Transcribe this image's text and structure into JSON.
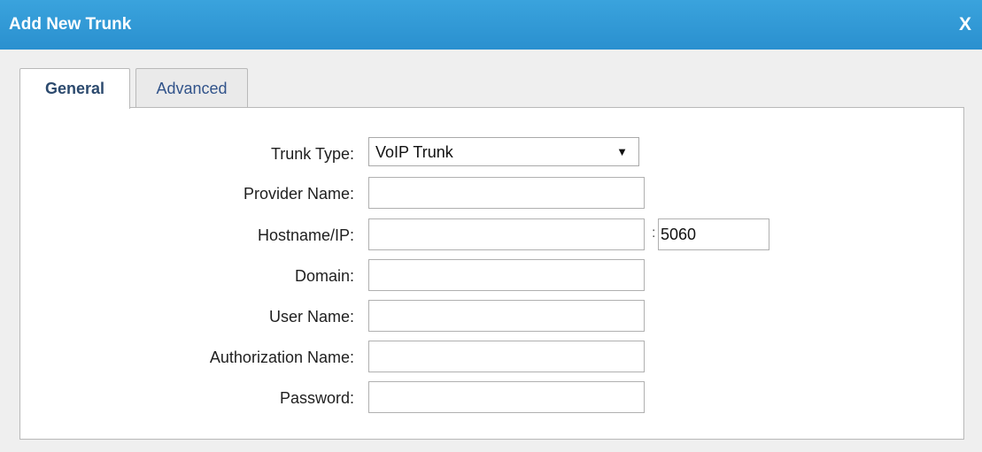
{
  "dialog": {
    "title": "Add New Trunk",
    "close_label": "X",
    "title_bar_color": "#2f98d6"
  },
  "tabs": [
    {
      "label": "General",
      "active": true
    },
    {
      "label": "Advanced",
      "active": false
    }
  ],
  "form": {
    "trunk_type": {
      "label": "Trunk Type:",
      "value": "VoIP Trunk",
      "icon": "dropdown-arrow-icon",
      "arrow": "▼"
    },
    "provider_name": {
      "label": "Provider Name:",
      "value": ""
    },
    "hostname": {
      "label": "Hostname/IP:",
      "value": "",
      "port_separator": ":",
      "port_value": "5060"
    },
    "domain": {
      "label": "Domain:",
      "value": ""
    },
    "user_name": {
      "label": "User Name:",
      "value": ""
    },
    "authorization_name": {
      "label": "Authorization Name:",
      "value": ""
    },
    "password": {
      "label": "Password:",
      "value": ""
    }
  }
}
